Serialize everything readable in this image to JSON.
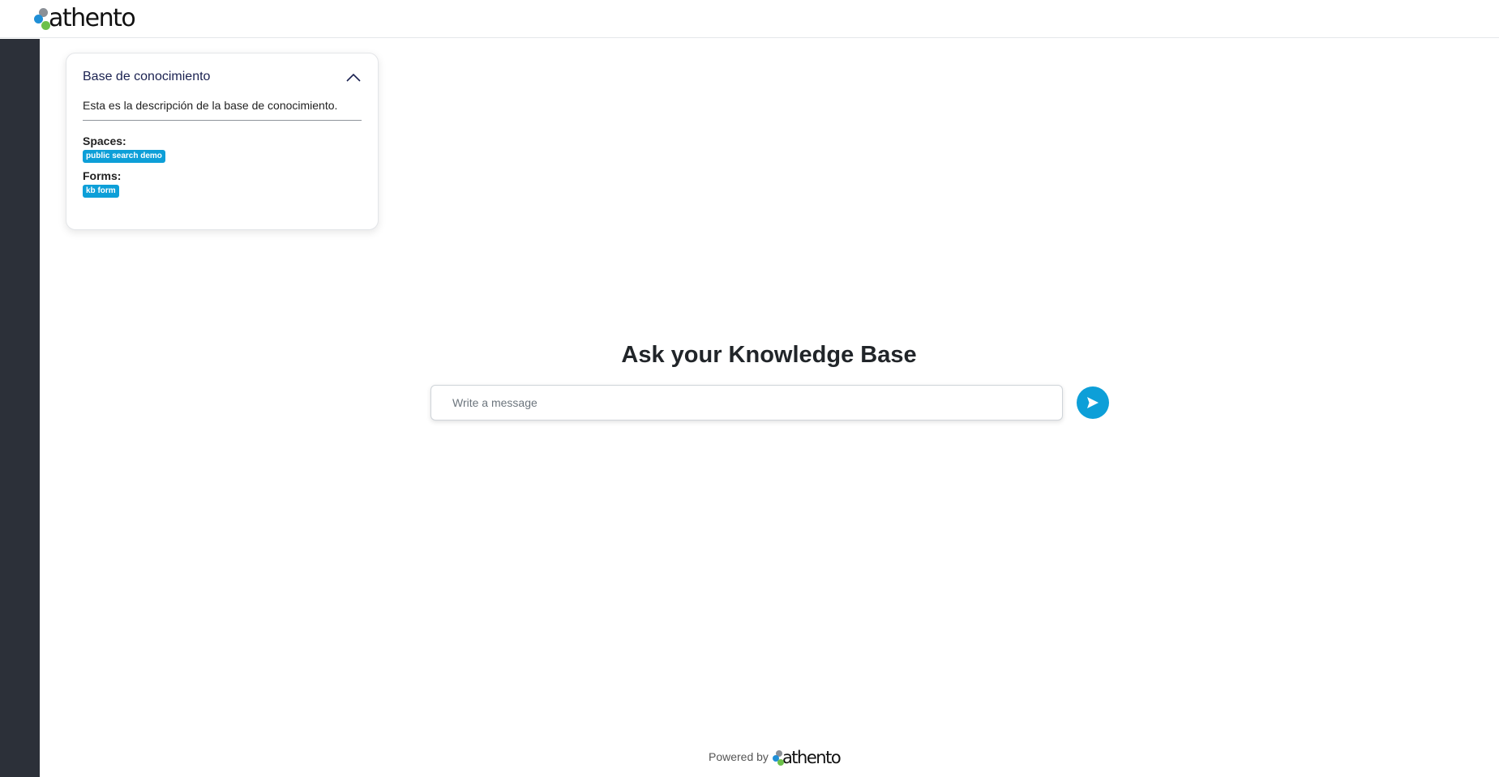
{
  "brand": {
    "logo_text": "athento",
    "logo_icon": "athento-dots-logo",
    "colors": {
      "dot_gray": "#8a8f96",
      "dot_blue": "#1f8fd6",
      "dot_green": "#6cc04a"
    }
  },
  "sidebar": {
    "background": "#2c3039"
  },
  "knowledge_card": {
    "title": "Base de conocimiento",
    "toggle_icon": "chevron-up-icon",
    "description": "Esta es la descripción de la base de conocimiento.",
    "spaces_label": "Spaces:",
    "spaces": [
      "public search demo"
    ],
    "forms_label": "Forms:",
    "forms": [
      "kb form"
    ],
    "badge_color": "#0d9fd8"
  },
  "chat": {
    "heading": "Ask your Knowledge Base",
    "input_value": "",
    "input_placeholder": "Write a message",
    "send_icon": "send-icon",
    "accent": "#0d9fd8"
  },
  "footer": {
    "powered_by": "Powered by",
    "logo_text": "athento"
  }
}
